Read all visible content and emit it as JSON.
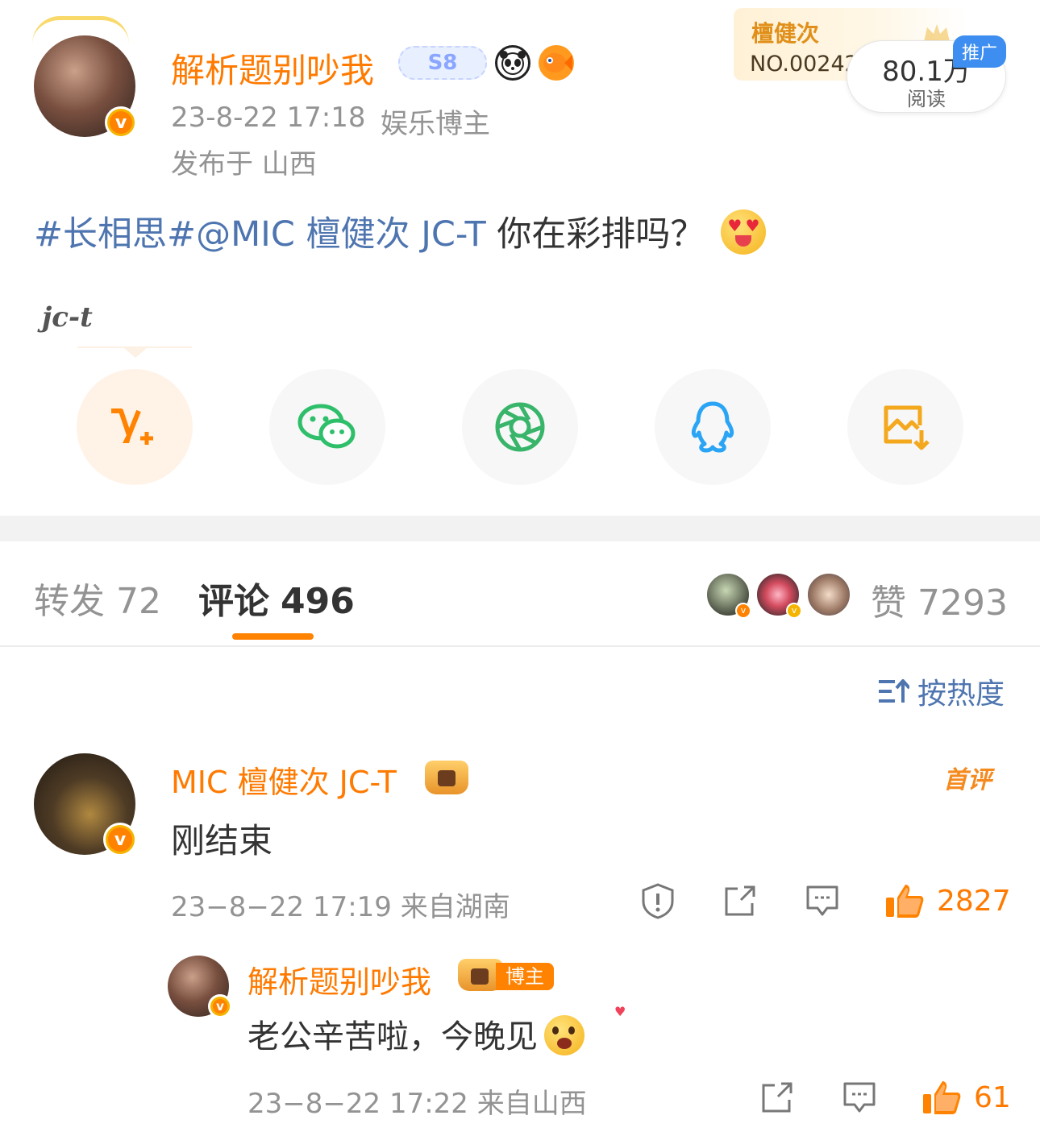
{
  "post": {
    "author": "解析题别吵我",
    "level_badge": "S8",
    "timestamp": "23-8-22 17:18",
    "author_tag": "娱乐博主",
    "location": "发布于 山西",
    "topic": "#长相思#",
    "mention": "@MIC 檀健次 JC-T",
    "text": " 你在彩排吗？",
    "watermark": "jc-t"
  },
  "promo": {
    "title": "檀健次",
    "number": "NO.00242",
    "reads": "80.1万",
    "reads_label": "阅读",
    "tag": "推广"
  },
  "share": [
    "v-plus-icon",
    "wechat-icon",
    "moments-icon",
    "qq-icon",
    "save-image-icon"
  ],
  "tabs": {
    "repost_label": "转发",
    "repost_count": "72",
    "comment_label": "评论",
    "comment_count": "496",
    "like_label": "赞",
    "like_count": "7293"
  },
  "sort_label": "按热度",
  "comments": [
    {
      "name": "MIC 檀健次 JC-T",
      "text": "刚结束",
      "meta": "23−8−22 17:19  来自湖南",
      "first_tag": "首评",
      "likes": "2827"
    },
    {
      "name": "解析题别吵我",
      "owner_tag": "博主",
      "text": "老公辛苦啦，今晚见",
      "meta": "23−8−22 17:22  来自山西",
      "likes": "61"
    }
  ],
  "colors": {
    "accent": "#ff8200",
    "link": "#4e75b0",
    "gray": "#939393"
  }
}
